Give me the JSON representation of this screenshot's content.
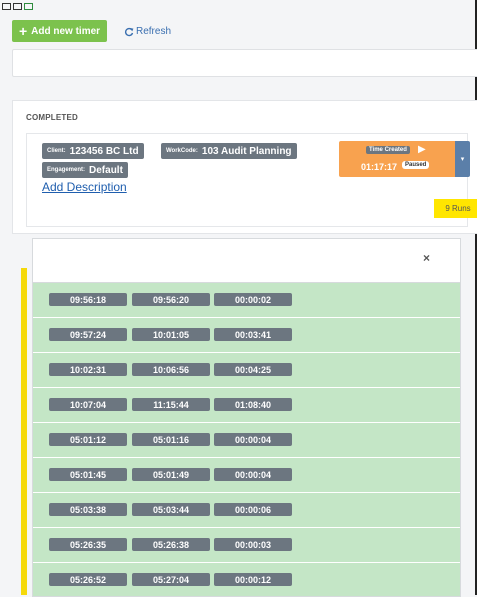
{
  "toolbar": {
    "add_label": "Add new timer",
    "refresh_label": "Refresh"
  },
  "section": {
    "title": "COMPLETED"
  },
  "timer": {
    "client_key": "Client:",
    "client_value": "123456 BC Ltd",
    "workcode_key": "WorkCode:",
    "workcode_value": "103 Audit Planning",
    "engagement_key": "Engagement:",
    "engagement_value": "Default",
    "add_description": "Add Description",
    "time_created_label": "Time Created",
    "elapsed": "01:17:17",
    "status": "Paused",
    "runs_label": "9 Runs"
  },
  "runs_panel": {
    "close": "×",
    "rows": [
      {
        "start": "09:56:18",
        "end": "09:56:20",
        "duration": "00:00:02"
      },
      {
        "start": "09:57:24",
        "end": "10:01:05",
        "duration": "00:03:41"
      },
      {
        "start": "10:02:31",
        "end": "10:06:56",
        "duration": "00:04:25"
      },
      {
        "start": "10:07:04",
        "end": "11:15:44",
        "duration": "01:08:40"
      },
      {
        "start": "05:01:12",
        "end": "05:01:16",
        "duration": "00:00:04"
      },
      {
        "start": "05:01:45",
        "end": "05:01:49",
        "duration": "00:00:04"
      },
      {
        "start": "05:03:38",
        "end": "05:03:44",
        "duration": "00:00:06"
      },
      {
        "start": "05:26:35",
        "end": "05:26:38",
        "duration": "00:00:03"
      },
      {
        "start": "05:26:52",
        "end": "05:27:04",
        "duration": "00:00:12"
      }
    ]
  },
  "colors": {
    "add_button": "#7cc24d",
    "tag": "#6c7680",
    "time_button": "#f8a24f",
    "dropdown_button": "#5b7fa9",
    "runs_badge": "#ffe600",
    "runs_background": "#c4e6c6",
    "accent_bar": "#f5d90a"
  }
}
